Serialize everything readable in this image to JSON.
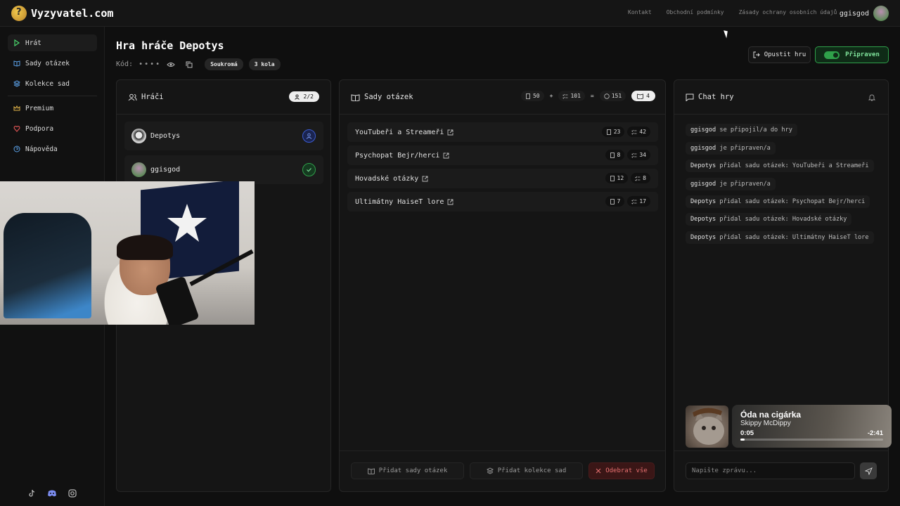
{
  "app": {
    "logo_text": "Vyzyvatel.com"
  },
  "topnav": {
    "links": [
      "Kontakt",
      "Obchodní podmínky",
      "Zásady ochrany osobních údajů"
    ],
    "username": "ggisgod"
  },
  "sidebar": {
    "items": [
      {
        "label": "Hrát",
        "icon": "play-icon",
        "color": "#4ad66d",
        "active": true
      },
      {
        "label": "Sady otázek",
        "icon": "book-icon",
        "color": "#5aa0e6"
      },
      {
        "label": "Kolekce sad",
        "icon": "layers-icon",
        "color": "#5aa0e6"
      },
      {
        "label": "Premium",
        "icon": "crown-icon",
        "color": "#e8b94a"
      },
      {
        "label": "Podpora",
        "icon": "heart-icon",
        "color": "#e05555"
      },
      {
        "label": "Nápověda",
        "icon": "help-circle-icon",
        "color": "#5aa0e6"
      }
    ],
    "social": [
      "tiktok-icon",
      "discord-icon",
      "instagram-icon"
    ]
  },
  "header": {
    "title": "Hra hráče Depotys",
    "code_label": "Kód:",
    "code_masked": "••••",
    "privacy_badge": "Soukromá",
    "rounds_badge": "3 kola",
    "leave_label": "Opustit hru",
    "ready_label": "Připraven"
  },
  "players": {
    "title": "Hráči",
    "count": "2/2",
    "list": [
      {
        "name": "Depotys",
        "status": "host"
      },
      {
        "name": "ggisgod",
        "status": "ready"
      }
    ]
  },
  "question_sets": {
    "title": "Sady otázek",
    "totals": {
      "a": "50",
      "plus": "+",
      "b": "101",
      "eq": "=",
      "sum": "151",
      "sets": "4"
    },
    "sets": [
      {
        "name": "YouTubeři a Streameři",
        "a": "23",
        "b": "42"
      },
      {
        "name": "Psychopat Bejr/herci",
        "a": "8",
        "b": "34"
      },
      {
        "name": "Hovadské otázky",
        "a": "12",
        "b": "8"
      },
      {
        "name": "Ultimátny HaiseT lore",
        "a": "7",
        "b": "17"
      }
    ],
    "add_sets_label": "Přidat sady otázek",
    "add_collections_label": "Přidat kolekce sad",
    "remove_all_label": "Odebrat vše"
  },
  "chat": {
    "title": "Chat hry",
    "messages": [
      {
        "user": "ggisgod",
        "text": " se připojil/a do hry"
      },
      {
        "user": "ggisgod",
        "text": " je připraven/a"
      },
      {
        "user": "Depotys",
        "text": " přidal sadu otázek: YouTubeři a Streameři"
      },
      {
        "user": "ggisgod",
        "text": " je připraven/a"
      },
      {
        "user": "Depotys",
        "text": " přidal sadu otázek: Psychopat Bejr/herci"
      },
      {
        "user": "Depotys",
        "text": " přidal sadu otázek: Hovadské otázky"
      },
      {
        "user": "Depotys",
        "text": " přidal sadu otázek: Ultimátny HaiseT lore"
      }
    ],
    "input_placeholder": "Napište zprávu..."
  },
  "music": {
    "title": "Óda na cigárka",
    "artist": "Skippy McDippy",
    "current": "0:05",
    "remaining": "-2:41",
    "progress": 0.03
  }
}
